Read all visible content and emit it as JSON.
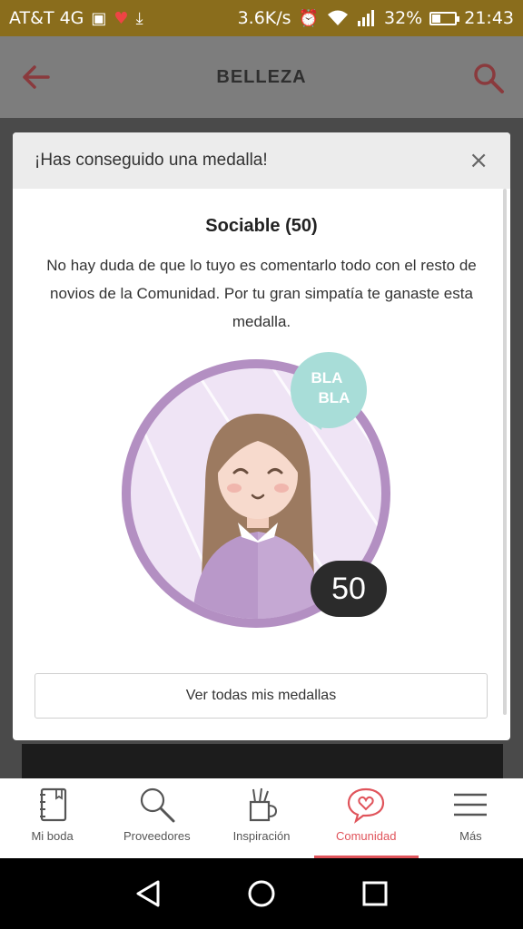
{
  "status": {
    "carrier": "AT&T 4G",
    "speed": "3.6K/s",
    "battery": "32%",
    "battery_level": 0.32,
    "time": "21:43"
  },
  "appbar": {
    "title": "BELLEZA"
  },
  "modal": {
    "header": "¡Has conseguido una medalla!",
    "close": "×",
    "medal_name": "Sociable (50)",
    "description": "No hay duda de que lo tuyo es comentarlo todo con el resto de novios de la Comunidad. Por tu gran simpatía te ganaste esta medalla.",
    "bubble_line1": "BLA",
    "bubble_line2": "BLA",
    "badge_number": "50",
    "button": "Ver todas mis medallas"
  },
  "bottom_nav": {
    "items": [
      {
        "label": "Mi boda"
      },
      {
        "label": "Proveedores"
      },
      {
        "label": "Inspiración"
      },
      {
        "label": "Comunidad"
      },
      {
        "label": "Más"
      }
    ],
    "active_index": 3
  },
  "colors": {
    "accent": "#e0545b",
    "medal_purple": "#b38fc2",
    "bubble_teal": "#a8ddd8"
  }
}
